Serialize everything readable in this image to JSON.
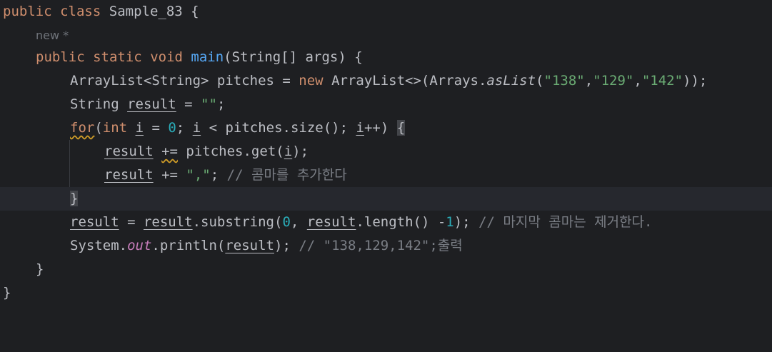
{
  "lines": {
    "l1": {
      "kw_public": "public",
      "kw_class": "class",
      "class_name": "Sample_83",
      "brace": "{"
    },
    "l2": {
      "hint": "new *"
    },
    "l3": {
      "kw_public": "public",
      "kw_static": "static",
      "kw_void": "void",
      "method": "main",
      "params": "(String[] args) {"
    },
    "l4": {
      "t1": "ArrayList<String> pitches = ",
      "kw_new": "new",
      "t2": " ArrayList<>(Arrays.",
      "call": "asList",
      "t3": "(",
      "s1": "\"138\"",
      "c1": ",",
      "s2": "\"129\"",
      "c2": ",",
      "s3": "\"142\"",
      "t4": "));"
    },
    "l5": {
      "t1": "String ",
      "var": "result",
      "t2": " = ",
      "str": "\"\"",
      "t3": ";"
    },
    "l6": {
      "kw_for": "for",
      "t1": "(",
      "kw_int": "int",
      "sp": " ",
      "i1": "i",
      "t2": " = ",
      "n0": "0",
      "t3": "; ",
      "i2": "i",
      "t4": " < pitches.size(); ",
      "i3": "i",
      "t5": "++) ",
      "brace": "{"
    },
    "l7": {
      "var": "result",
      "sp": " ",
      "op": "+=",
      "t1": " pitches.get(",
      "i": "i",
      "t2": ");"
    },
    "l8": {
      "var": "result",
      "t1": " += ",
      "str": "\",\"",
      "t2": "; ",
      "comment": "// 콤마를 추가한다"
    },
    "l9": {
      "brace": "}"
    },
    "l10": {
      "var1": "result",
      "t1": " = ",
      "var2": "result",
      "t2": ".substring(",
      "n0": "0",
      "t3": ", ",
      "var3": "result",
      "t4": ".length() -",
      "n1": "1",
      "t5": "); ",
      "comment": "// 마지막 콤마는 제거한다."
    },
    "l11": {
      "t1": "System.",
      "field": "out",
      "t2": ".println(",
      "var": "result",
      "t3": "); ",
      "comment": "// \"138,129,142\";출력"
    },
    "l12": {
      "brace": "}"
    },
    "l13": {
      "brace": "}"
    }
  }
}
